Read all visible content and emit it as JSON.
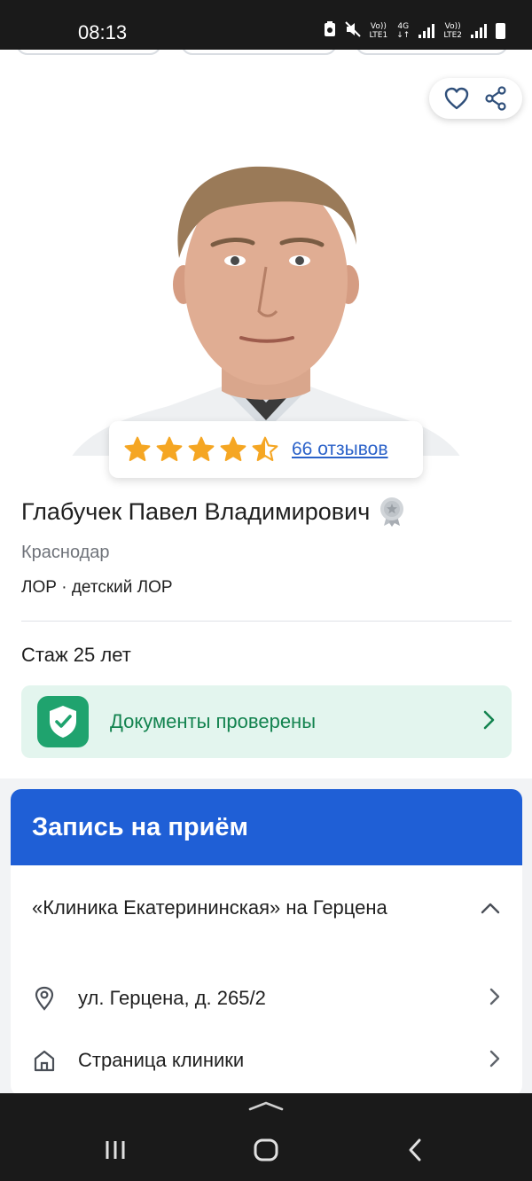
{
  "status_bar": {
    "time": "08:13",
    "icons": [
      "battery-saver-icon",
      "mute-icon",
      "volte-lte1-icon",
      "4g-icon",
      "signal-icon",
      "volte-lte2-icon",
      "signal-icon",
      "battery-icon"
    ],
    "lte1_top": "Vo))",
    "lte1_bottom": "LTE1",
    "net_top": "4G",
    "net_bottom": "↓↑",
    "lte2_top": "Vo))",
    "lte2_bottom": "LTE2"
  },
  "actions": {
    "favorite_icon": "heart-icon",
    "share_icon": "share-icon"
  },
  "rating": {
    "value": 4.5,
    "max": 5,
    "reviews_label": "66 отзывов",
    "star_color": "#f5a623"
  },
  "doctor": {
    "name": "Глабучек Павел Владимирович",
    "city": "Краснодар",
    "specialty_main": "ЛОР",
    "specialty_separator": " · ",
    "specialty_extra": "детский ЛОР",
    "experience": "Стаж 25 лет",
    "documents_verified": "Документы проверены"
  },
  "booking": {
    "title": "Запись на приём",
    "clinic_name": "«Клиника Екатерининская» на Герцена",
    "address": "ул. Герцена, д. 265/2",
    "clinic_page": "Страница клиники",
    "accent_color": "#1f5fd6"
  },
  "colors": {
    "verified_bg": "#e3f5ee",
    "verified_text": "#13834f",
    "link": "#2b62c9"
  }
}
